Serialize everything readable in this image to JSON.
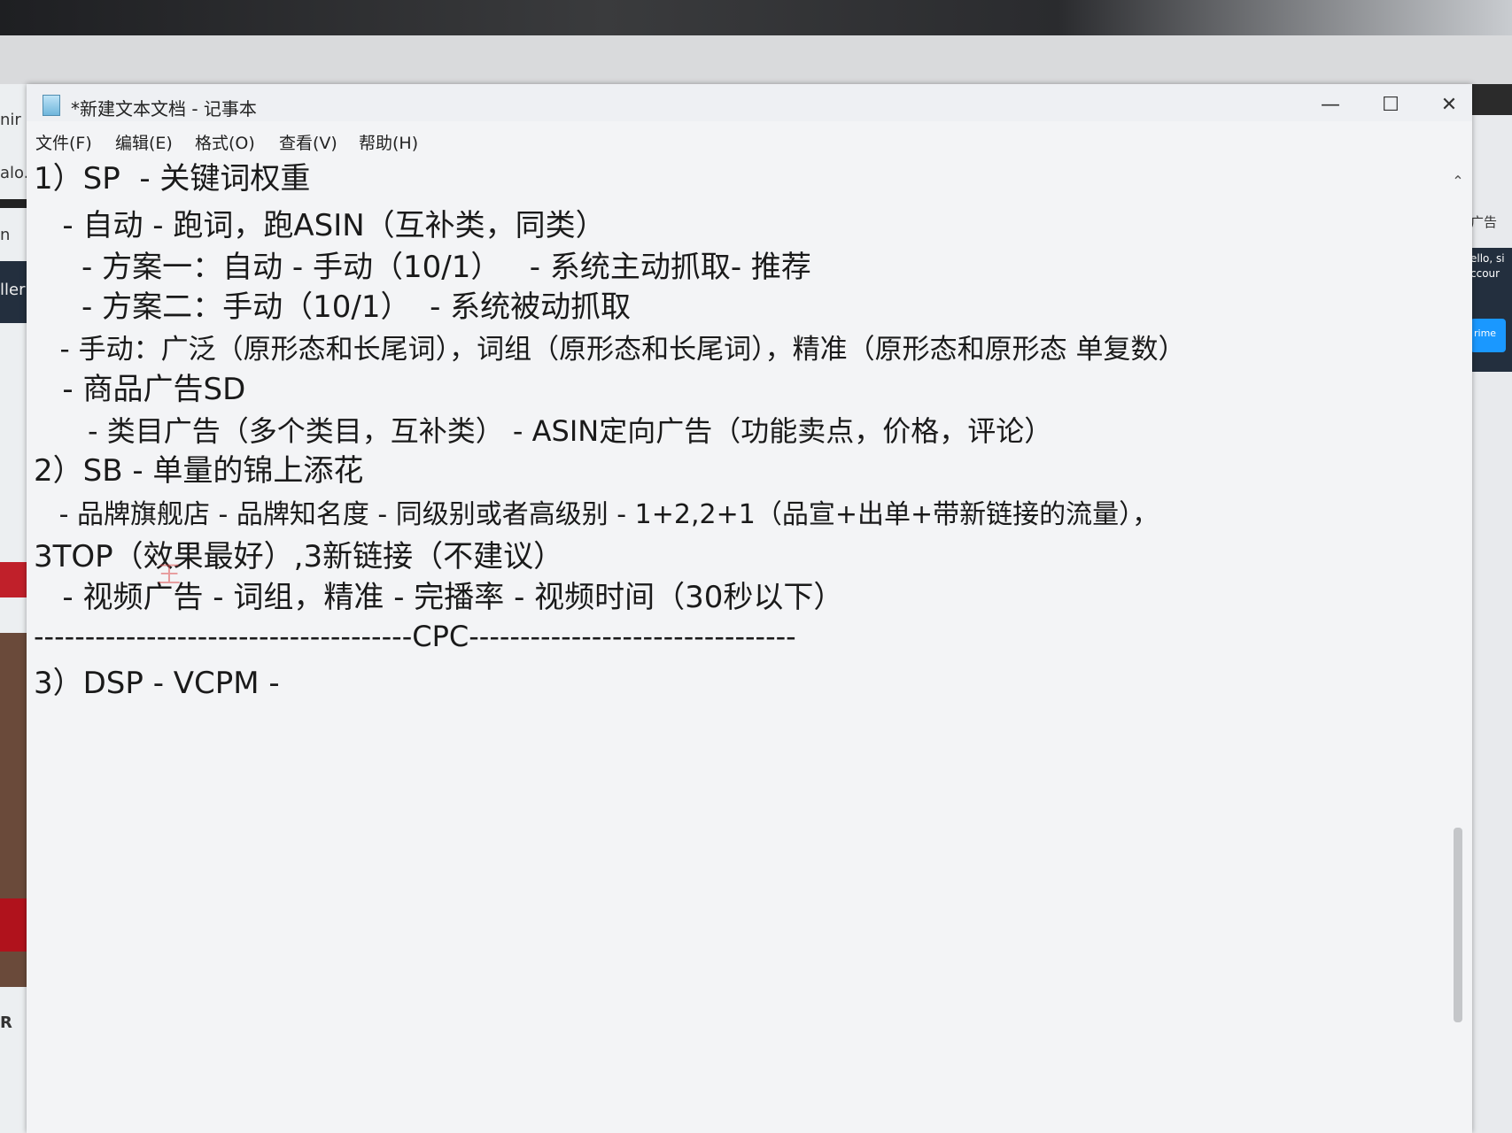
{
  "window": {
    "title": "*新建文本文档 - 记事本",
    "minimize_glyph": "—",
    "maximize_glyph": "☐",
    "close_glyph": "✕"
  },
  "menu": {
    "items": [
      "文件(F)",
      "编辑(E)",
      "格式(O)",
      "查看(V)",
      "帮助(H)"
    ]
  },
  "browser_tab": {
    "plus": "+"
  },
  "background_left": {
    "fragments": [
      "nir",
      "alo.",
      "n",
      "ller",
      "R"
    ]
  },
  "background_right": {
    "fragments": [
      "广告",
      "ello, si",
      "ccour",
      "rime"
    ]
  },
  "document": {
    "lines": [
      "1）SP  - 关键词权重",
      "   - 自动 - 跑词，跑ASIN（互补类，同类）",
      "     - 方案一：自动 - 手动（10/1）   - 系统主动抓取- 推荐",
      "     - 方案二：手动（10/1）  - 系统被动抓取",
      "   - 手动：广泛（原形态和长尾词），词组（原形态和长尾词），精准（原形态和原形态 单复数）",
      "   - 商品广告SD",
      "      - 类目广告（多个类目，互补类） - ASIN定向广告（功能卖点，价格，评论）",
      "2）SB - 单量的锦上添花",
      "   - 品牌旗舰店 - 品牌知名度 - 同级别或者高级别 - 1+2,2+1（品宣+出单+带新链接的流量），",
      "3TOP（效果最好）,3新链接（不建议）",
      "   - 视频广告 - 词组，精准 - 完播率 - 视频时间（30秒以下）",
      "-------------------------------------CPC--------------------------------",
      "3）DSP - VCPM -"
    ],
    "watermark": "王"
  },
  "colors": {
    "window_bg": "#f3f4f6",
    "text": "#1a1a1a"
  }
}
